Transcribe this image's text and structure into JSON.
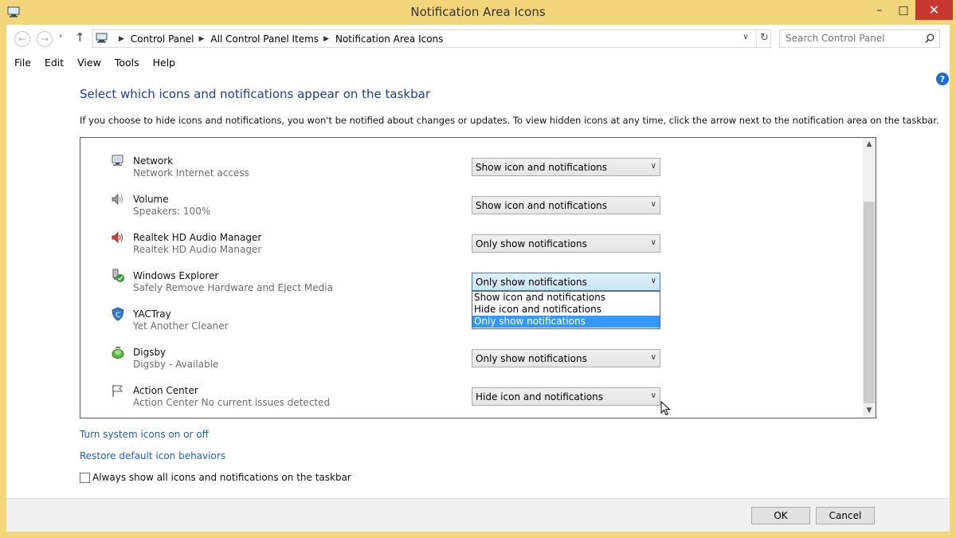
{
  "window": {
    "title": "Notification Area Icons"
  },
  "titlebar": {
    "minimize": "–",
    "maximize": "□",
    "close": "✕"
  },
  "nav": {
    "back": "←",
    "forward": "→",
    "recent": "▾",
    "up": "↑"
  },
  "address": {
    "crumbs": [
      "Control Panel",
      "All Control Panel Items",
      "Notification Area Icons"
    ],
    "separator": "▶",
    "dropdown": "∨",
    "refresh": "↻"
  },
  "search": {
    "placeholder": "Search Control Panel"
  },
  "menu": [
    "File",
    "Edit",
    "View",
    "Tools",
    "Help"
  ],
  "help": {
    "label": "?"
  },
  "main": {
    "heading": "Select which icons and notifications appear on the taskbar",
    "description": "If you choose to hide icons and notifications, you won't be notified about changes or updates. To view hidden icons at any time, click the arrow next to the notification area on the taskbar."
  },
  "select_arrow": "∨",
  "rows": [
    {
      "name": "Network",
      "desc": "Network Internet access",
      "value": "Show icon and notifications",
      "icon": "network-icon"
    },
    {
      "name": "Volume",
      "desc": "Speakers: 100%",
      "value": "Show icon and notifications",
      "icon": "speaker-icon"
    },
    {
      "name": "Realtek HD Audio Manager",
      "desc": "Realtek HD Audio Manager",
      "value": "Only show notifications",
      "icon": "realtek-speaker-icon"
    },
    {
      "name": "Windows Explorer",
      "desc": "Safely Remove Hardware and Eject Media",
      "value": "Only show notifications",
      "icon": "usb-eject-icon"
    },
    {
      "name": "YACTray",
      "desc": "Yet Another Cleaner",
      "value": "",
      "icon": "shield-icon"
    },
    {
      "name": "Digsby",
      "desc": "Digsby - Available",
      "value": "Only show notifications",
      "icon": "digsby-icon"
    },
    {
      "name": "Action Center",
      "desc": "Action Center  No current issues detected",
      "value": "Hide icon and notifications",
      "icon": "flag-icon"
    }
  ],
  "dropdown": {
    "options": [
      "Show icon and notifications",
      "Hide icon and notifications",
      "Only show notifications"
    ],
    "selected": "Only show notifications"
  },
  "scroll": {
    "up": "▲",
    "down": "▼"
  },
  "links": {
    "system_icons": "Turn system icons on or off",
    "restore": "Restore default icon behaviors"
  },
  "always_show": {
    "label": "Always show all icons and notifications on the taskbar",
    "checked": false
  },
  "buttons": {
    "ok": "OK",
    "cancel": "Cancel"
  },
  "colors": {
    "titlebar": "#f4d67a",
    "heading": "#1e3f8f",
    "link": "#1e5fb8",
    "selection": "#3399ff",
    "close": "#c7382e"
  }
}
